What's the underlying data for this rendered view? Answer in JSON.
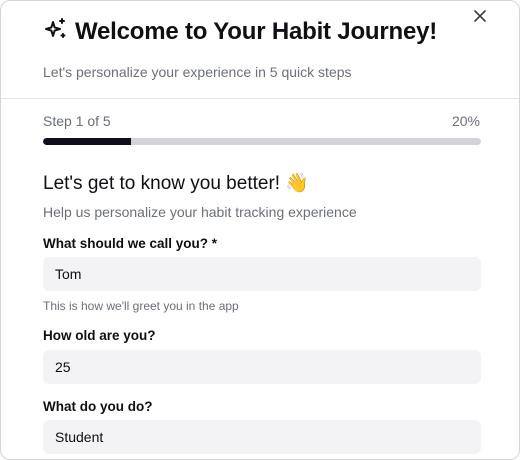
{
  "dialog": {
    "close_icon": "x-icon",
    "title_icon": "sparkles-icon",
    "title": "Welcome to Your Habit Journey!",
    "subtitle": "Let's personalize your experience in 5 quick steps"
  },
  "progress": {
    "step_label": "Step 1 of 5",
    "percent_label": "20%",
    "value": 0.2,
    "fill_color": "#0f0f19",
    "track_color": "#d4d4d8"
  },
  "section": {
    "title": "Let's get to know you better! 👋",
    "subtitle": "Help us personalize your habit tracking experience"
  },
  "form": {
    "name": {
      "label": "What should we call you? *",
      "value": "Tom",
      "hint": "This is how we'll greet you in the app"
    },
    "age": {
      "label": "How old are you?",
      "value": "25"
    },
    "occupation": {
      "label": "What do you do?",
      "value": "Student"
    }
  }
}
